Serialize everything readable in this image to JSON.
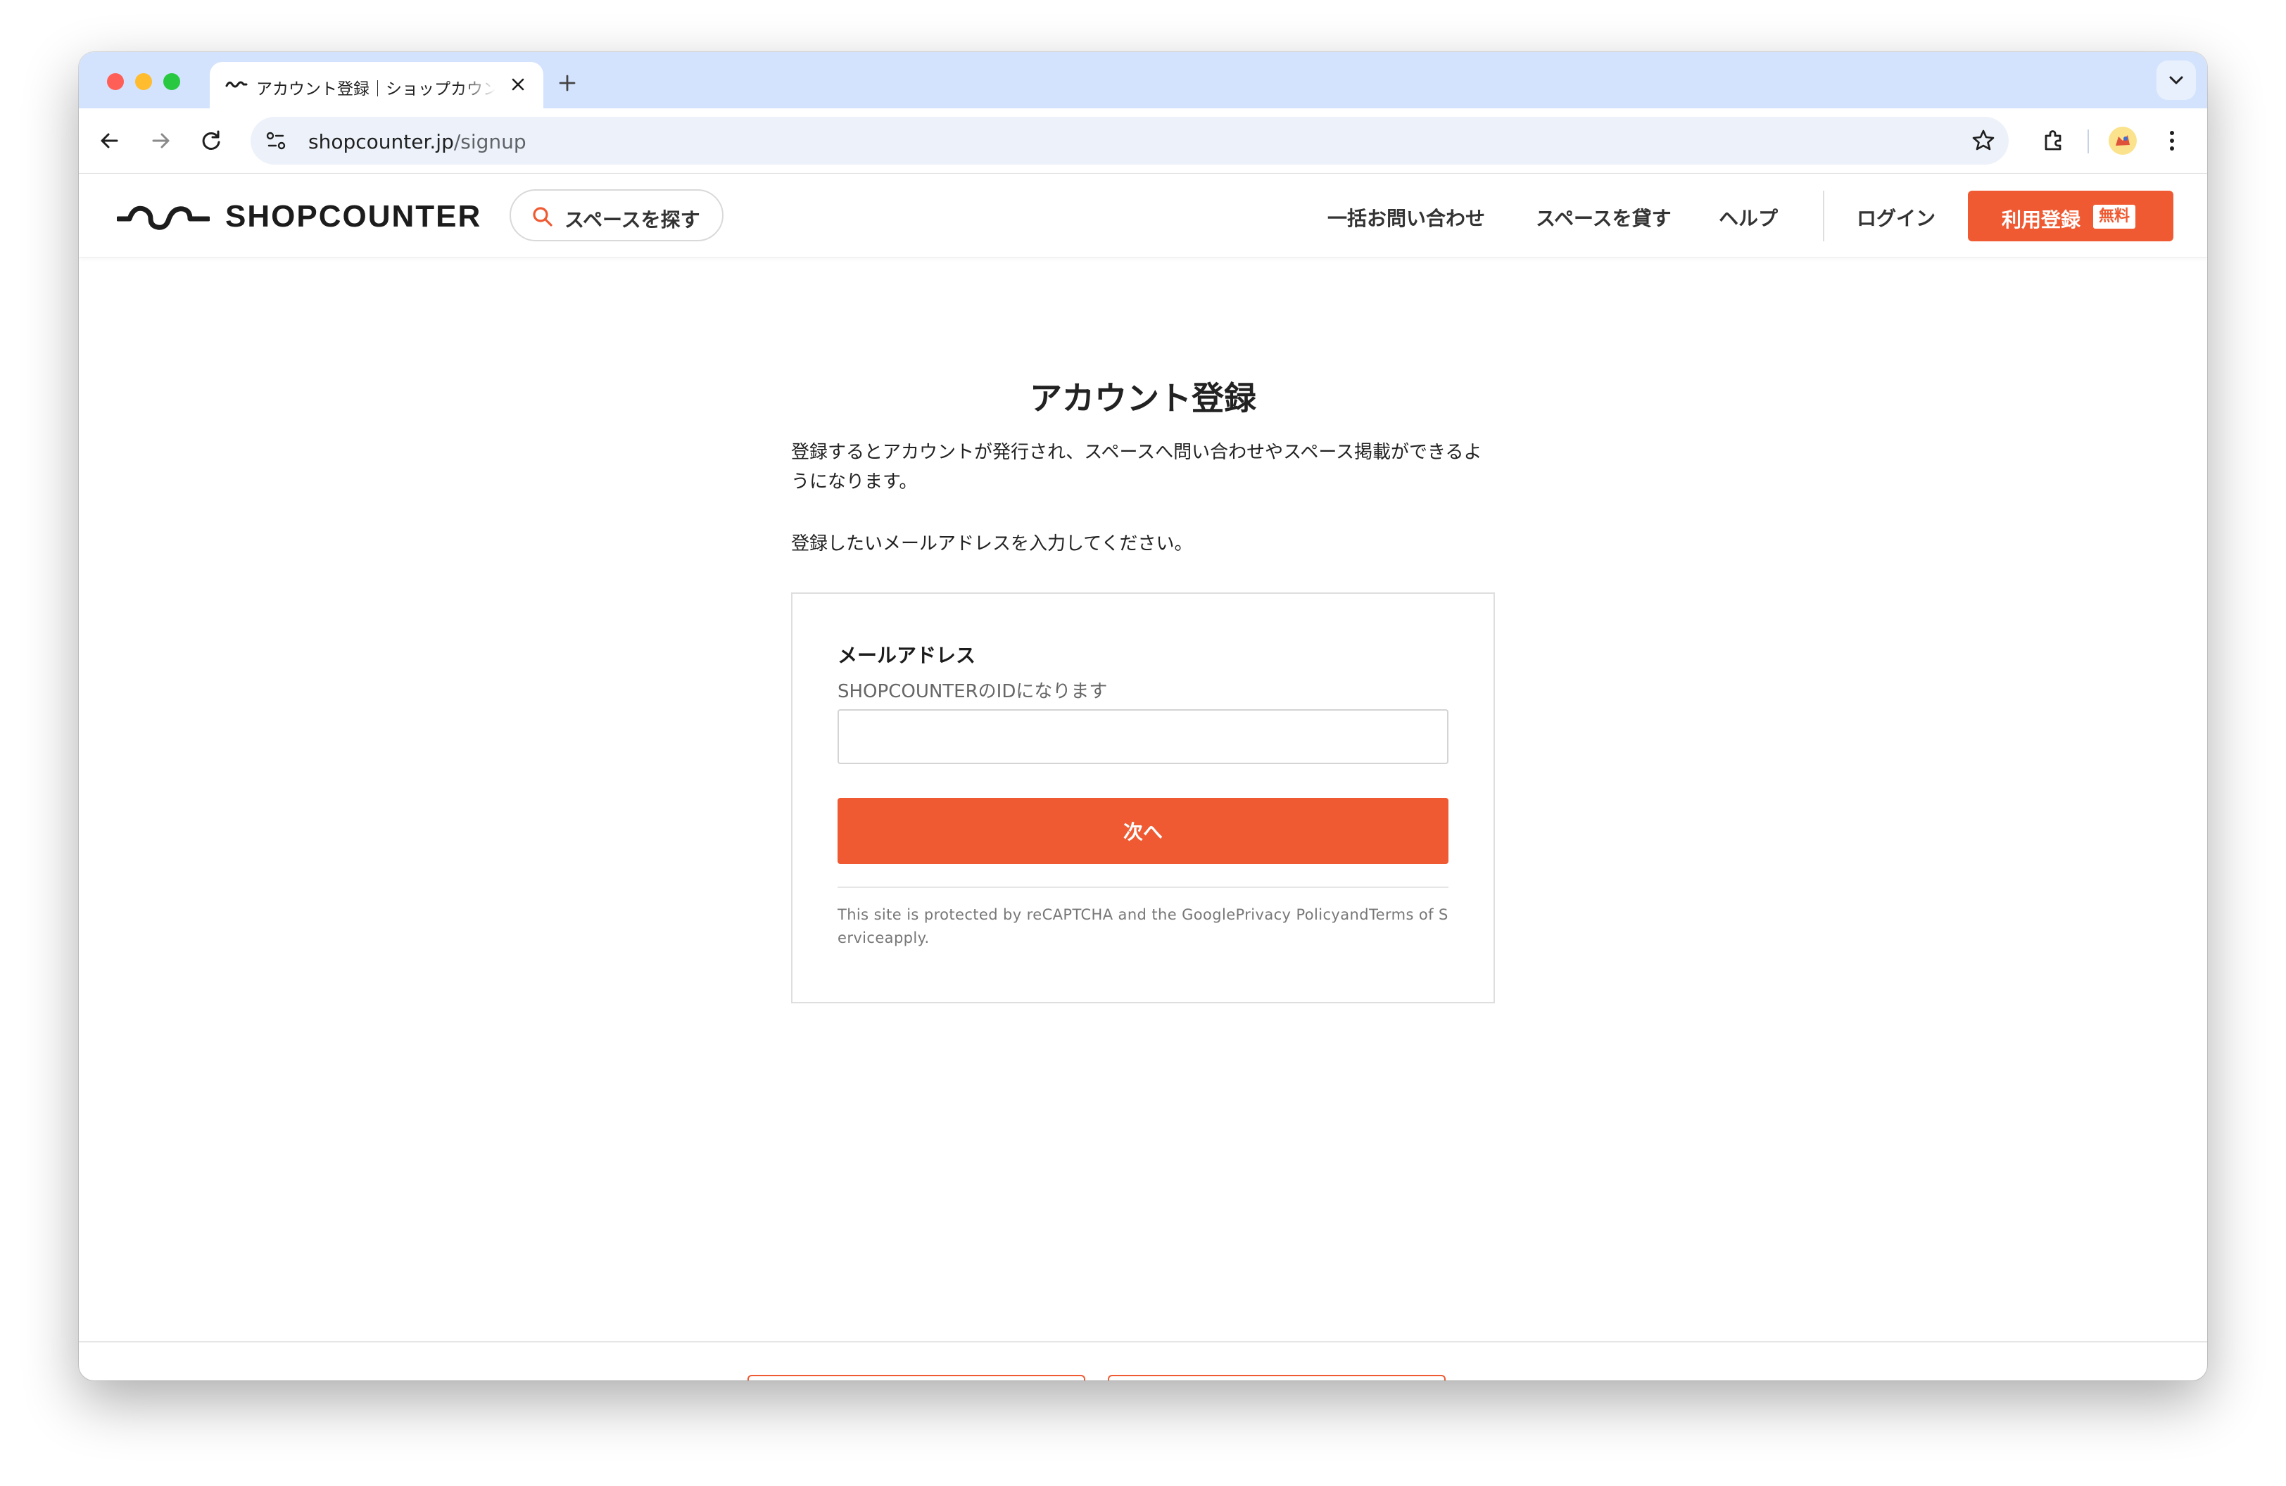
{
  "browser": {
    "tab": {
      "title": "アカウント登録｜ショップカウンター",
      "close_icon": "close-icon",
      "favicon_icon": "shopcounter-favicon-icon"
    },
    "new_tab_icon": "plus-icon",
    "tab_search_icon": "chevron-down-icon",
    "url": {
      "host": "shopcounter.jp",
      "path": "/signup"
    }
  },
  "header": {
    "logo_text": "SHOPCOUNTER",
    "search_label": "スペースを探す",
    "nav": {
      "bulk_inquiry": "一括お問い合わせ",
      "list_space": "スペースを貸す",
      "help": "ヘルプ",
      "login": "ログイン"
    },
    "signup": {
      "label": "利用登録",
      "badge": "無料"
    }
  },
  "main": {
    "title": "アカウント登録",
    "intro": "登録するとアカウントが発行され、スペースへ問い合わせやスペース掲載ができるようになります。",
    "instruction": "登録したいメールアドレスを入力してください。",
    "form": {
      "email_label": "メールアドレス",
      "email_help": "SHOPCOUNTERのIDになります",
      "email_value": "",
      "next_button": "次へ",
      "recaptcha_note": "This site is protected by reCAPTCHA and the GooglePrivacy PolicyandTerms of Serviceapply."
    }
  },
  "colors": {
    "accent": "#ef5a32",
    "tabstrip": "#d3e3fd",
    "omnibox": "#edf2fa"
  }
}
